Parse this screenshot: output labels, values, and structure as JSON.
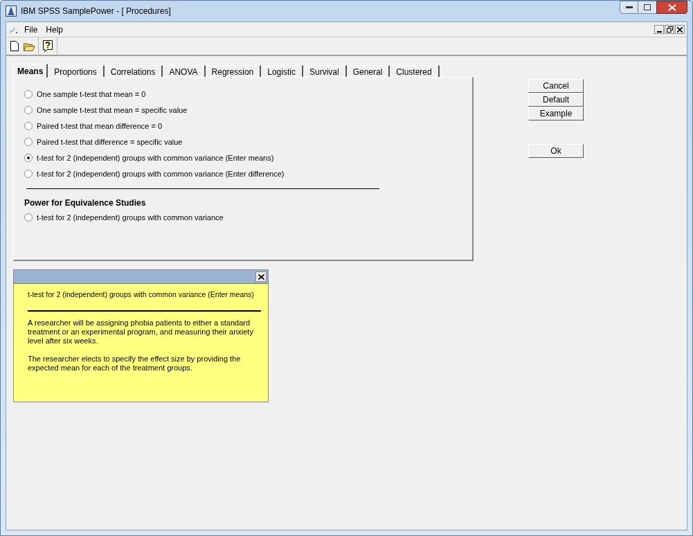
{
  "window": {
    "title": "IBM SPSS SamplePower - [ Procedures]"
  },
  "menu": [
    "File",
    "Help"
  ],
  "tabs": [
    {
      "label": "Means",
      "selected": true
    },
    {
      "label": "Proportions",
      "selected": false
    },
    {
      "label": "Correlations",
      "selected": false
    },
    {
      "label": "ANOVA",
      "selected": false
    },
    {
      "label": "Regression",
      "selected": false
    },
    {
      "label": "Logistic",
      "selected": false
    },
    {
      "label": "Survival",
      "selected": false
    },
    {
      "label": "General",
      "selected": false
    },
    {
      "label": "Clustered",
      "selected": false
    }
  ],
  "options": [
    {
      "label": "One sample t-test that mean = 0",
      "selected": false
    },
    {
      "label": "One sample t-test that mean = specific value",
      "selected": false
    },
    {
      "label": "Paired t-test that mean difference = 0",
      "selected": false
    },
    {
      "label": "Paired t-test that difference = specific value",
      "selected": false
    },
    {
      "label": "t-test for 2 (independent) groups with common variance (Enter means)",
      "selected": true
    },
    {
      "label": "t-test for 2 (independent) groups with common variance (Enter difference)",
      "selected": false
    }
  ],
  "equivalence": {
    "heading": "Power for Equivalence Studies",
    "options": [
      {
        "label": "t-test for 2 (independent) groups with common variance",
        "selected": false
      }
    ]
  },
  "buttons": [
    "Cancel",
    "Default",
    "Example"
  ],
  "ok_button": "Ok",
  "help_panel": {
    "title": "t-test for 2 (independent) groups with common variance (Enter means)",
    "paragraphs": [
      "A researcher will be assigning phobia patients to either a standard treatment or an experimental program, and measuring their anxiety level after six weeks.",
      "The researcher elects to specify the effect size by providing the expected mean for each of the treatment groups."
    ]
  }
}
